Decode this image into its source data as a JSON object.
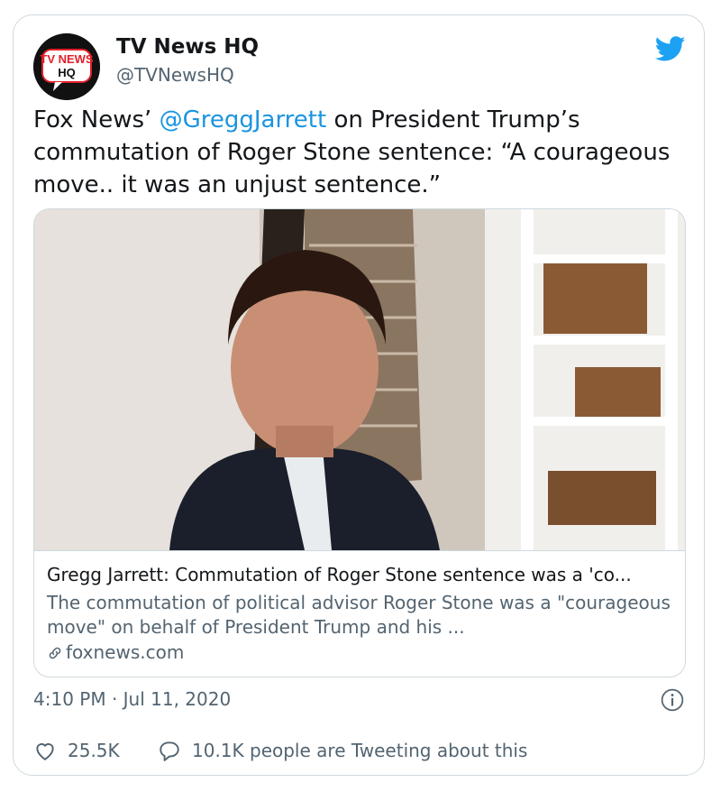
{
  "author": {
    "name": "TV News HQ",
    "handle": "@TVNewsHQ",
    "avatar_text_line1": "TV NEWS",
    "avatar_text_line2": "HQ"
  },
  "tweet": {
    "text_part1": "Fox News’ ",
    "mention": "@GreggJarrett",
    "text_part2": " on President Trump’s commutation of Roger Stone sentence: “A courageous move.. it was an unjust sentence.”"
  },
  "card": {
    "title": "Gregg Jarrett: Commutation of Roger Stone sentence was a 'co...",
    "description": "The commutation of political advisor Roger Stone was a \"courageous move\" on behalf of President Trump and his ...",
    "domain": "foxnews.com"
  },
  "timestamp": "4:10 PM · Jul 11, 2020",
  "actions": {
    "likes": "25.5K",
    "replies_label": "10.1K people are Tweeting about this"
  },
  "icons": {
    "brand": "twitter-bird-icon",
    "info": "info-icon",
    "like": "heart-icon",
    "reply": "speech-bubble-icon",
    "link": "link-icon"
  },
  "colors": {
    "accent": "#1b95e0",
    "muted": "#536471",
    "twitter_blue": "#1da1f2",
    "avatar_red": "#e0202a"
  }
}
